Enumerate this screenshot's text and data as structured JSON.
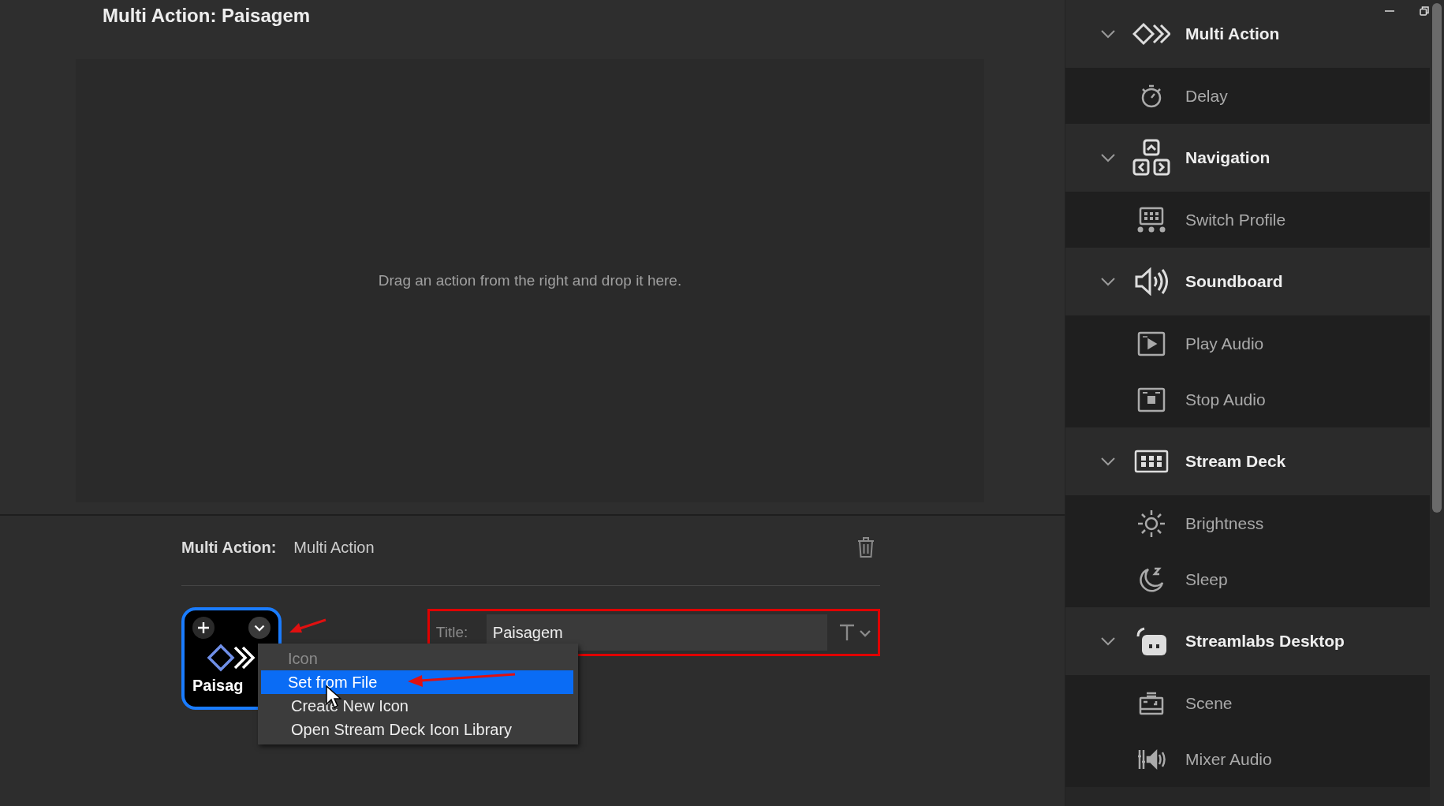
{
  "editor": {
    "title": "Multi Action: Paisagem",
    "placeholder_text": "Drag an action from the right and drop it here."
  },
  "properties": {
    "action_label": "Multi Action:",
    "action_value": "Multi Action",
    "key": {
      "caption": "Paisag"
    },
    "title_field": {
      "label": "Title:",
      "value": "Paisagem"
    },
    "context_menu": [
      {
        "kind": "header",
        "label": "Icon"
      },
      {
        "kind": "item",
        "label": "Set from File",
        "selected": true
      },
      {
        "kind": "item",
        "label": "Create New Icon",
        "selected": false
      },
      {
        "kind": "item",
        "label": "Open Stream Deck Icon Library",
        "selected": false
      }
    ]
  },
  "sidebar": {
    "groups": [
      {
        "label": "Multi Action",
        "expanded": true,
        "items": [
          {
            "label": "Delay"
          }
        ]
      },
      {
        "label": "Navigation",
        "expanded": true,
        "items": [
          {
            "label": "Switch Profile"
          }
        ]
      },
      {
        "label": "Soundboard",
        "expanded": true,
        "items": [
          {
            "label": "Play Audio"
          },
          {
            "label": "Stop Audio"
          }
        ]
      },
      {
        "label": "Stream Deck",
        "expanded": true,
        "items": [
          {
            "label": "Brightness"
          },
          {
            "label": "Sleep"
          }
        ]
      },
      {
        "label": "Streamlabs Desktop",
        "expanded": true,
        "items": [
          {
            "label": "Scene"
          },
          {
            "label": "Mixer Audio"
          }
        ]
      }
    ]
  }
}
